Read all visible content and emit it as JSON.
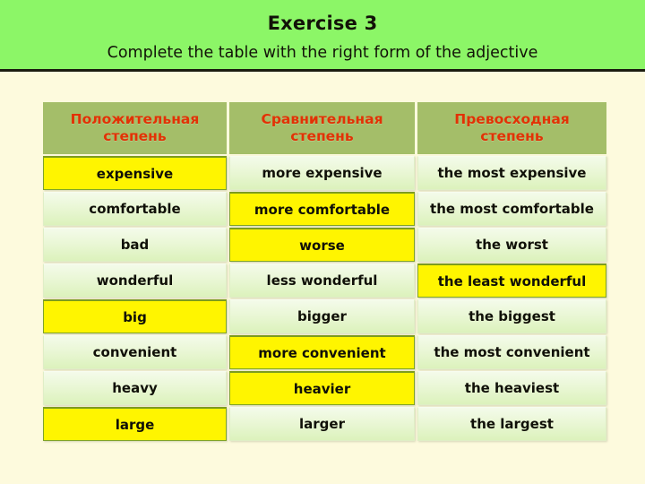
{
  "banner": {
    "title": "Exercise 3",
    "subtitle": "Complete the table with the right form of the adjective",
    "background_color": "#8CF667",
    "text_color": "#121208"
  },
  "table": {
    "header_background": "#A4BE69",
    "header_text_color": "#E23205",
    "highlight_color": "#FFF500",
    "cell_background": "#EAF7D6",
    "headers": [
      "Положительная степень",
      "Сравнительная степень",
      "Превосходная степень"
    ],
    "rows": [
      {
        "positive": "expensive",
        "comparative": "more expensive",
        "superlative": "the most expensive",
        "highlight": "positive"
      },
      {
        "positive": "comfortable",
        "comparative": "more comfortable",
        "superlative": "the most comfortable",
        "highlight": "comparative"
      },
      {
        "positive": "bad",
        "comparative": "worse",
        "superlative": "the worst",
        "highlight": "comparative"
      },
      {
        "positive": "wonderful",
        "comparative": "less wonderful",
        "superlative": "the least wonderful",
        "highlight": "superlative"
      },
      {
        "positive": "big",
        "comparative": "bigger",
        "superlative": "the biggest",
        "highlight": "positive"
      },
      {
        "positive": "convenient",
        "comparative": "more convenient",
        "superlative": "the most convenient",
        "highlight": "comparative"
      },
      {
        "positive": "heavy",
        "comparative": "heavier",
        "superlative": "the heaviest",
        "highlight": "comparative"
      },
      {
        "positive": "large",
        "comparative": "larger",
        "superlative": "the largest",
        "highlight": "positive"
      }
    ]
  }
}
